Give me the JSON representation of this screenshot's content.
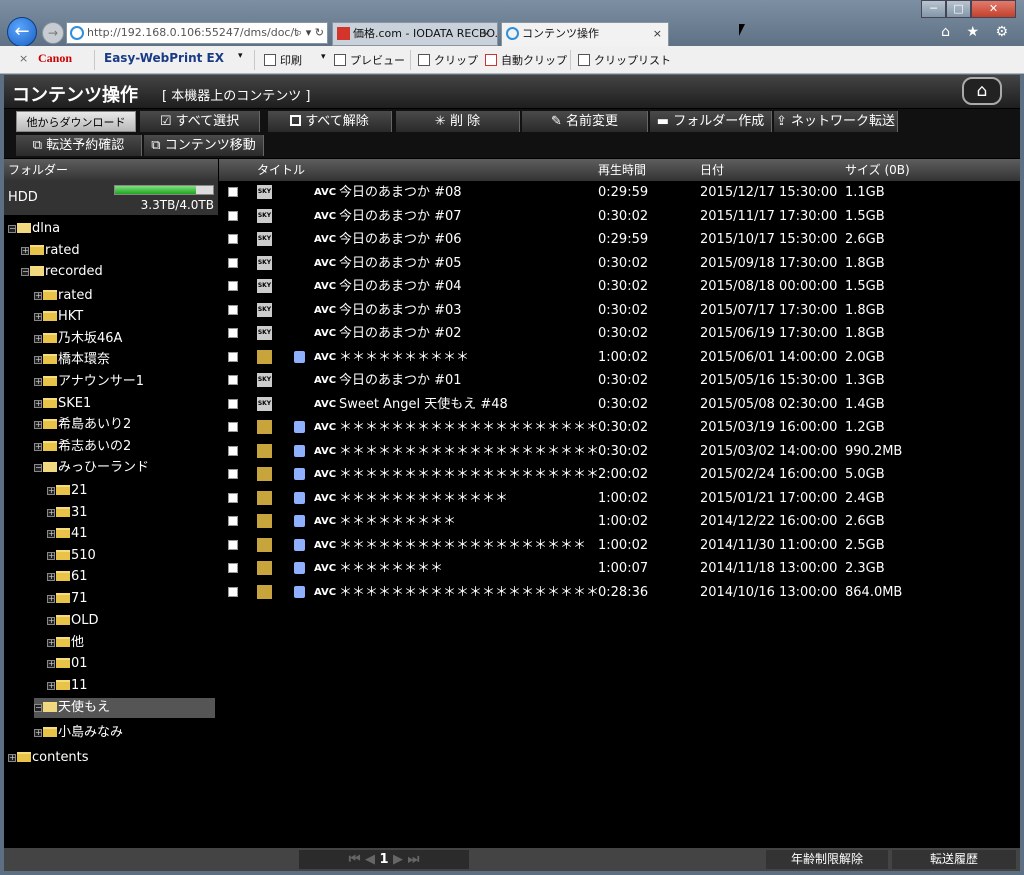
{
  "browser": {
    "address": "http://192.168.0.106:55247/dms/doc/t",
    "tabs": [
      {
        "label": "価格.com - IODATA RECBO..."
      },
      {
        "label": "コンテンツ操作"
      }
    ],
    "window_buttons": {
      "min": "─",
      "max": "□",
      "close": "✕"
    },
    "right_icons": "⌂ ★ ⚙",
    "command_bar": {
      "close": "×",
      "brand": "Canon",
      "product": "Easy-WebPrint EX",
      "print": "印刷",
      "preview": "プレビュー",
      "clip": "クリップ",
      "auto_clip": "自動クリップ",
      "clip_list": "クリップリスト"
    }
  },
  "app": {
    "title": "コンテンツ操作",
    "subtitle": "[ 本機器上のコンテンツ ]",
    "toolbar": {
      "download": "他からダウンロード",
      "select_all": "すべて選択",
      "deselect_all": "すべて解除",
      "delete": "削 除",
      "rename": "名前変更",
      "new_folder": "フォルダー作成",
      "network_transfer": "ネットワーク転送",
      "transfer_reservation": "転送予約確認",
      "move_content": "コンテンツ移動"
    },
    "folder_pane": {
      "header": "フォルダー",
      "hdd_label": "HDD",
      "hdd_usage": "3.3TB/4.0TB",
      "hdd_fill": 0.83
    },
    "tree": [
      {
        "label": "dlna"
      },
      {
        "label": "rated"
      },
      {
        "label": "recorded"
      },
      {
        "label": "rated"
      },
      {
        "label": "HKT"
      },
      {
        "label": "乃木坂46A"
      },
      {
        "label": "橋本環奈"
      },
      {
        "label": "アナウンサー1"
      },
      {
        "label": "SKE1"
      },
      {
        "label": "希島あいり2"
      },
      {
        "label": "希志あいの2"
      },
      {
        "label": "みっひーランド"
      },
      {
        "label": "21"
      },
      {
        "label": "31"
      },
      {
        "label": "41"
      },
      {
        "label": "510"
      },
      {
        "label": "61"
      },
      {
        "label": "71"
      },
      {
        "label": "OLD"
      },
      {
        "label": "他"
      },
      {
        "label": "01"
      },
      {
        "label": "11"
      },
      {
        "label": "天使もえ"
      },
      {
        "label": "小島みなみ"
      },
      {
        "label": "contents"
      }
    ],
    "list": {
      "columns": {
        "title": "タイトル",
        "duration": "再生時間",
        "date": "日付",
        "size": "サイズ (0B)"
      },
      "rows": [
        {
          "ch": "SKY",
          "codec": "AVC",
          "title": "今日のあまつか #08",
          "duration": "0:29:59",
          "date": "2015/12/17 15:30:00",
          "size": "1.1GB"
        },
        {
          "ch": "SKY",
          "codec": "AVC",
          "title": "今日のあまつか #07",
          "duration": "0:30:02",
          "date": "2015/11/17 17:30:00",
          "size": "1.5GB"
        },
        {
          "ch": "SKY",
          "codec": "AVC",
          "title": "今日のあまつか #06",
          "duration": "0:29:59",
          "date": "2015/10/17 15:30:00",
          "size": "2.6GB"
        },
        {
          "ch": "SKY",
          "codec": "AVC",
          "title": "今日のあまつか #05",
          "duration": "0:30:02",
          "date": "2015/09/18 17:30:00",
          "size": "1.8GB"
        },
        {
          "ch": "SKY",
          "codec": "AVC",
          "title": "今日のあまつか #04",
          "duration": "0:30:02",
          "date": "2015/08/18 00:00:00",
          "size": "1.5GB"
        },
        {
          "ch": "SKY",
          "codec": "AVC",
          "title": "今日のあまつか #03",
          "duration": "0:30:02",
          "date": "2015/07/17 17:30:00",
          "size": "1.8GB"
        },
        {
          "ch": "SKY",
          "codec": "AVC",
          "title": "今日のあまつか #02",
          "duration": "0:30:02",
          "date": "2015/06/19 17:30:00",
          "size": "1.8GB"
        },
        {
          "ch": "REC",
          "codec": "AVC",
          "title": "＊＊＊＊＊＊＊＊＊＊",
          "duration": "1:00:02",
          "date": "2015/06/01 14:00:00",
          "size": "2.0GB",
          "locked": true
        },
        {
          "ch": "SKY",
          "codec": "AVC",
          "title": "今日のあまつか #01",
          "duration": "0:30:02",
          "date": "2015/05/16 15:30:00",
          "size": "1.3GB"
        },
        {
          "ch": "SKY",
          "codec": "AVC",
          "title": "Sweet Angel 天使もえ #48",
          "duration": "0:30:02",
          "date": "2015/05/08 02:30:00",
          "size": "1.4GB"
        },
        {
          "ch": "REC",
          "codec": "AVC",
          "title": "＊＊＊＊＊＊＊＊＊＊＊＊＊＊＊＊＊＊＊＊",
          "duration": "0:30:02",
          "date": "2015/03/19 16:00:00",
          "size": "1.2GB",
          "locked": true
        },
        {
          "ch": "REC",
          "codec": "AVC",
          "title": "＊＊＊＊＊＊＊＊＊＊＊＊＊＊＊＊＊＊＊＊",
          "duration": "0:30:02",
          "date": "2015/03/02 14:00:00",
          "size": "990.2MB",
          "locked": true
        },
        {
          "ch": "REC",
          "codec": "AVC",
          "title": "＊＊＊＊＊＊＊＊＊＊＊＊＊＊＊＊＊＊＊＊",
          "duration": "2:00:02",
          "date": "2015/02/24 16:00:00",
          "size": "5.0GB",
          "locked": true
        },
        {
          "ch": "REC",
          "codec": "AVC",
          "title": "＊＊＊＊＊＊＊＊＊＊＊＊＊",
          "duration": "1:00:02",
          "date": "2015/01/21 17:00:00",
          "size": "2.4GB",
          "locked": true
        },
        {
          "ch": "REC",
          "codec": "AVC",
          "title": "＊＊＊＊＊＊＊＊＊",
          "duration": "1:00:02",
          "date": "2014/12/22 16:00:00",
          "size": "2.6GB",
          "locked": true
        },
        {
          "ch": "REC",
          "codec": "AVC",
          "title": "＊＊＊＊＊＊＊＊＊＊＊＊＊＊＊＊＊＊＊",
          "duration": "1:00:02",
          "date": "2014/11/30 11:00:00",
          "size": "2.5GB",
          "locked": true
        },
        {
          "ch": "REC",
          "codec": "AVC",
          "title": "＊＊＊＊＊＊＊＊",
          "duration": "1:00:07",
          "date": "2014/11/18 13:00:00",
          "size": "2.3GB",
          "locked": true
        },
        {
          "ch": "REC",
          "codec": "AVC",
          "title": "＊＊＊＊＊＊＊＊＊＊＊＊＊＊＊＊＊＊＊＊",
          "duration": "0:28:36",
          "date": "2014/10/16 13:00:00",
          "size": "864.0MB",
          "locked": true
        }
      ]
    },
    "footer": {
      "page": "1",
      "age_unlock": "年齢制限解除",
      "transfer_history": "転送履歴"
    }
  }
}
